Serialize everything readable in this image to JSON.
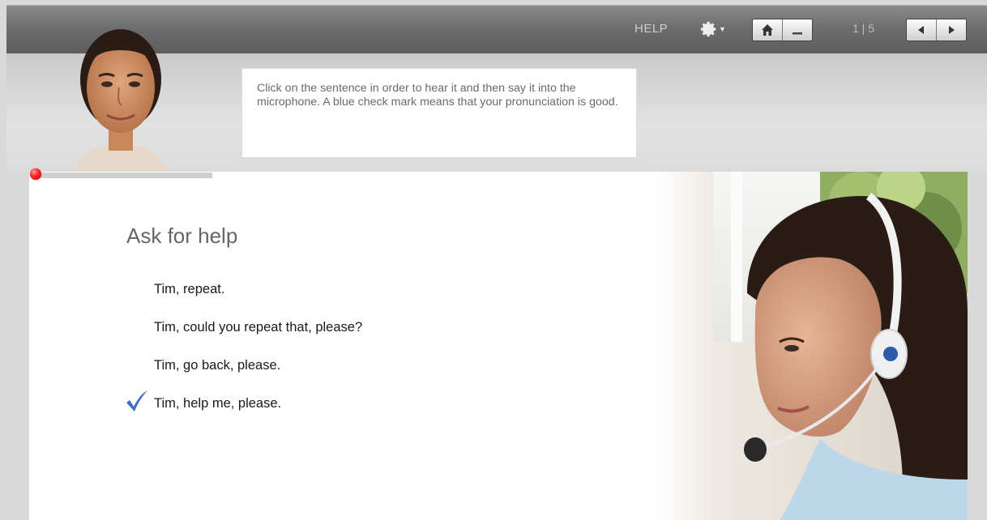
{
  "toolbar": {
    "help_label": "HELP",
    "page_indicator": "1 | 5"
  },
  "instruction": {
    "text": "Click on the sentence in order to hear it and then say it into the microphone. A blue check mark means that your pronunciation is good."
  },
  "exercise": {
    "title": "Ask for help",
    "sentences": [
      {
        "text": "Tim, repeat.",
        "checked": false
      },
      {
        "text": "Tim, could you repeat that, please?",
        "checked": false
      },
      {
        "text": "Tim, go back, please.",
        "checked": false
      },
      {
        "text": "Tim, help me, please.",
        "checked": true
      }
    ]
  },
  "colors": {
    "check_mark": "#3a6fc4",
    "record_indicator": "#e81c1c",
    "toolbar": "#6e6e6e"
  },
  "icons": [
    "gear-icon",
    "home-icon",
    "minimize-icon",
    "prev-arrow-icon",
    "next-arrow-icon",
    "check-icon",
    "record-indicator-icon"
  ]
}
